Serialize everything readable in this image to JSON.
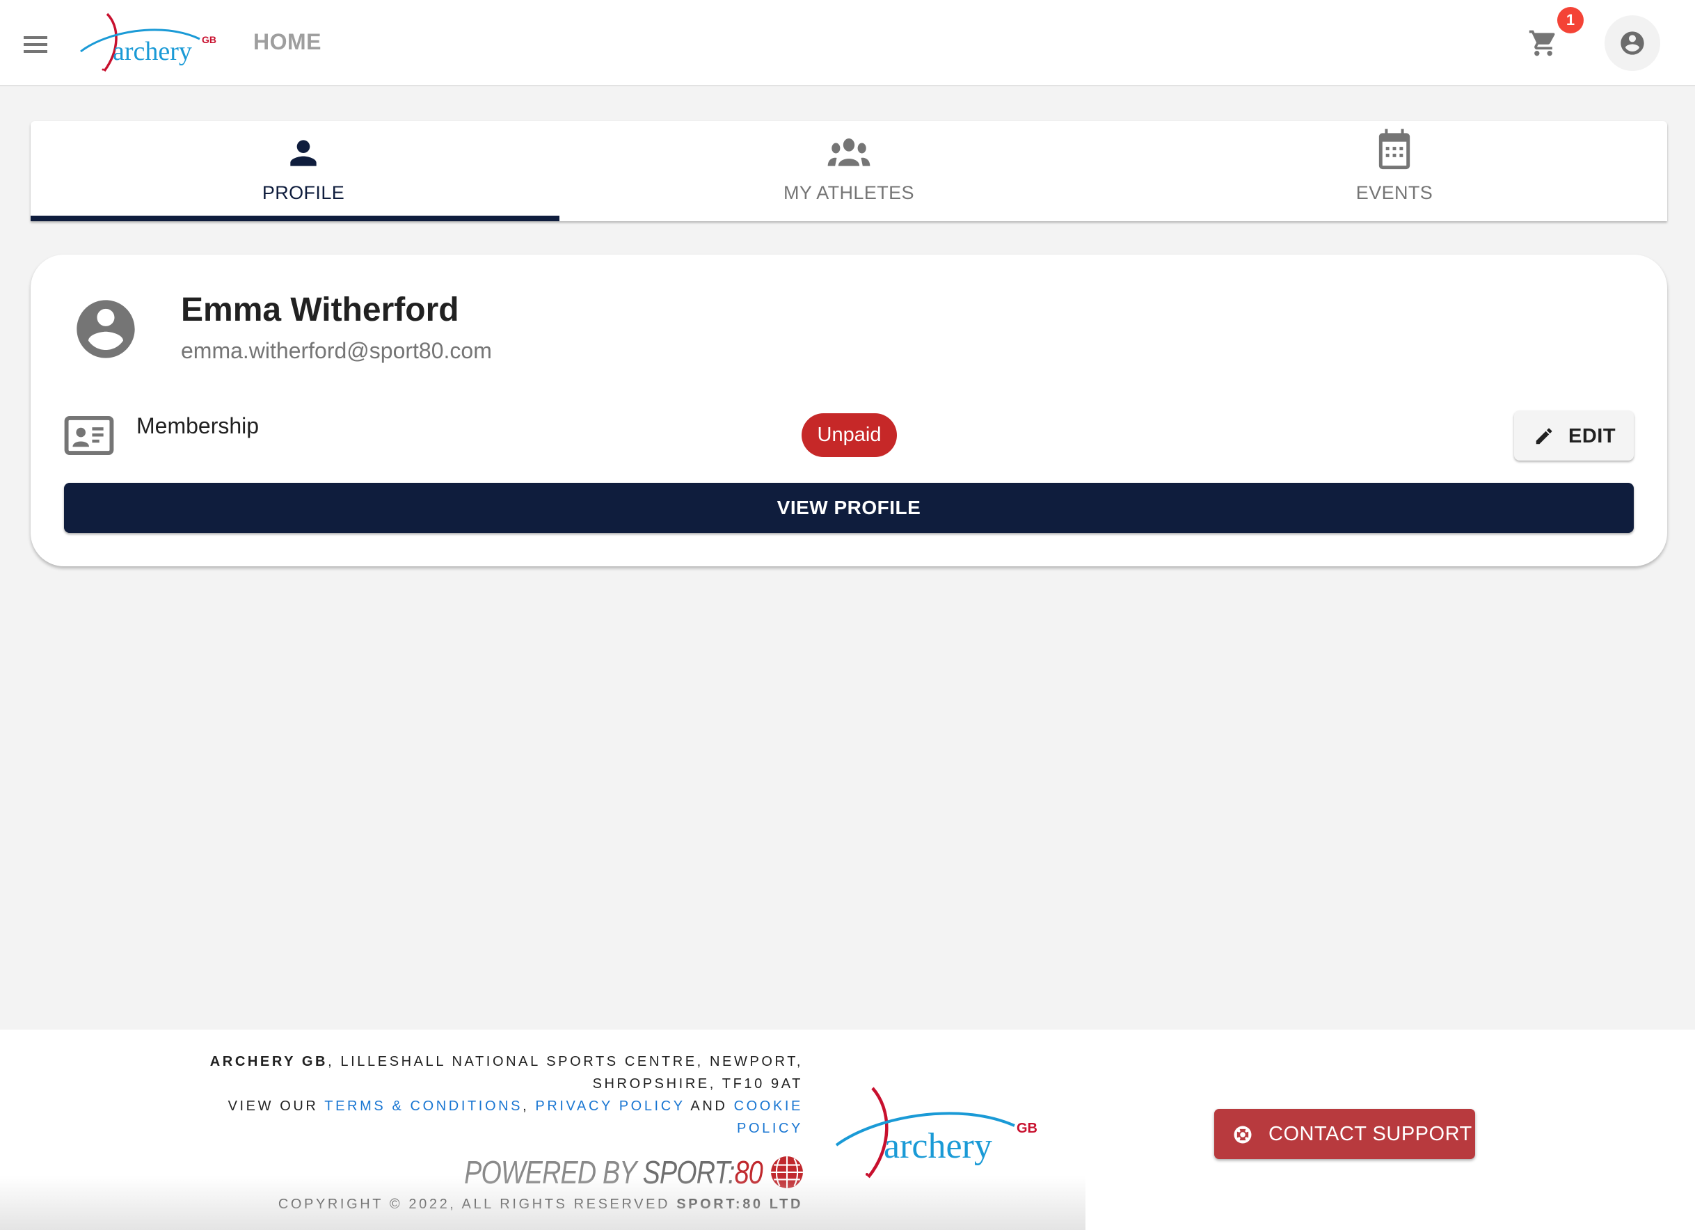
{
  "header": {
    "brand": "archery",
    "brand_suffix": "GB",
    "home_label": "HOME",
    "cart_count": "1"
  },
  "tabs": [
    {
      "label": "PROFILE",
      "icon": "person-icon",
      "active": true
    },
    {
      "label": "MY ATHLETES",
      "icon": "group-icon",
      "active": false
    },
    {
      "label": "EVENTS",
      "icon": "calendar-icon",
      "active": false
    }
  ],
  "profile": {
    "name": "Emma Witherford",
    "email": "emma.witherford@sport80.com",
    "membership_label": "Membership",
    "membership_status": "Unpaid",
    "edit_label": "EDIT",
    "view_profile_label": "VIEW PROFILE"
  },
  "colors": {
    "primary": "#0f1d3d",
    "status_unpaid": "#c62828",
    "support": "#b83a3e",
    "link": "#1976d2",
    "badge": "#f44336"
  },
  "footer": {
    "org_name": "ARCHERY GB",
    "address": ", LILLESHALL NATIONAL SPORTS CENTRE, NEWPORT, SHROPSHIRE, TF10 9AT",
    "view_our": "VIEW OUR ",
    "terms_link": "TERMS & CONDITIONS",
    "comma": ", ",
    "privacy_link": "PRIVACY POLICY",
    "and": " AND ",
    "cookie_link": "COOKIE POLICY",
    "powered_by": "POWERED BY ",
    "powered_sport": "SPORT:",
    "powered_80": "80",
    "copyright": "COPYRIGHT © 2022, ALL RIGHTS RESERVED ",
    "copyright_company": "SPORT:80 LTD",
    "logo_text": "archery",
    "logo_suffix": "GB",
    "contact_support_label": "CONTACT SUPPORT"
  }
}
